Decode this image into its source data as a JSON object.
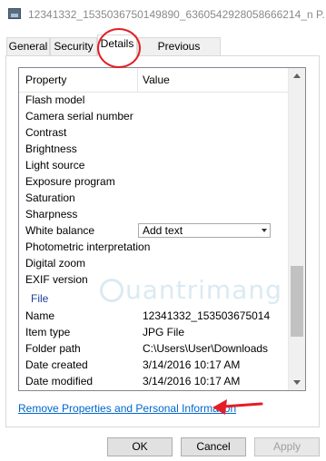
{
  "window": {
    "title": "12341332_1535036750149890_6360542928058666214_n P...",
    "icon": "image-file-icon"
  },
  "tabs": [
    {
      "label": "General"
    },
    {
      "label": "Security"
    },
    {
      "label": "Details"
    },
    {
      "label": "Previous Versions"
    }
  ],
  "active_tab": "Details",
  "grid": {
    "header_property": "Property",
    "header_value": "Value",
    "rows": [
      {
        "property": "Flash model",
        "value": ""
      },
      {
        "property": "Camera serial number",
        "value": ""
      },
      {
        "property": "Contrast",
        "value": ""
      },
      {
        "property": "Brightness",
        "value": ""
      },
      {
        "property": "Light source",
        "value": ""
      },
      {
        "property": "Exposure program",
        "value": ""
      },
      {
        "property": "Saturation",
        "value": ""
      },
      {
        "property": "Sharpness",
        "value": ""
      },
      {
        "property": "White balance",
        "value": "Add text"
      },
      {
        "property": "Photometric interpretation",
        "value": ""
      },
      {
        "property": "Digital zoom",
        "value": ""
      },
      {
        "property": "EXIF version",
        "value": ""
      }
    ],
    "section_file": "File",
    "file_rows": [
      {
        "property": "Name",
        "value": "12341332_153503675014..."
      },
      {
        "property": "Item type",
        "value": "JPG File"
      },
      {
        "property": "Folder path",
        "value": "C:\\Users\\User\\Downloads"
      },
      {
        "property": "Date created",
        "value": "3/14/2016 10:17 AM"
      },
      {
        "property": "Date modified",
        "value": "3/14/2016 10:17 AM"
      }
    ]
  },
  "watermark": "uantrimang",
  "link_text": "Remove Properties and Personal Information",
  "buttons": {
    "ok": "OK",
    "cancel": "Cancel",
    "apply": "Apply"
  },
  "colors": {
    "highlight": "#e41e25",
    "link": "#0066cc",
    "section": "#1f3f9c"
  }
}
